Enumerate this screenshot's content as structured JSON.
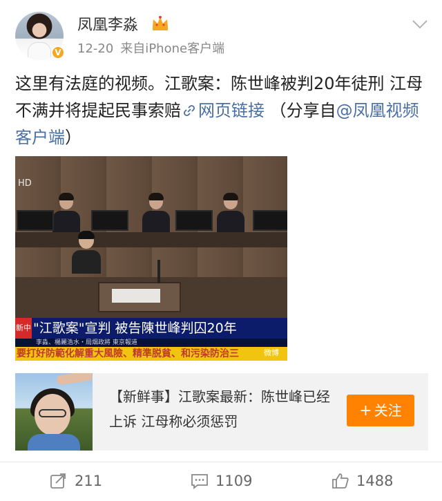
{
  "user": {
    "name": "凤凰李淼",
    "verified_badge": "V",
    "time": "12-20",
    "source": "来自iPhone客户端"
  },
  "post": {
    "text": "这里有法庭的视频。江歌案：陈世峰被判20年徒刑 江母不满并将提起民事索赔",
    "link_label": "网页链接",
    "share_prefix": "（分享自",
    "share_mention": "@凤凰视频客户端",
    "share_suffix": "）"
  },
  "video": {
    "hd_label": "HD",
    "channel_logo": "新中",
    "headline": "\"江歌案\"宣判 被告陳世峰判囚20年",
    "subline": "李淼、楊麗浩水・局烟政將  東京報道",
    "ticker": "要打好防範化解重大風險、精準脱貧、和污染防治三",
    "watermark": "微博"
  },
  "related": {
    "text": "【新鲜事】江歌案最新：陈世峰已经上诉 江母称必须惩罚",
    "follow_label": "关注",
    "follow_plus": "+"
  },
  "actions": {
    "repost_count": "211",
    "comment_count": "1109",
    "like_count": "1488"
  },
  "colors": {
    "accent": "#ff8200",
    "link": "#4a6fa5",
    "crown": "#f5a623",
    "ticker_bg": "#f1c40f",
    "lower_third_bg": "#0c1c6a"
  },
  "icons": {
    "more": "chevron-down-icon",
    "crown": "crown-icon",
    "link": "link-icon",
    "repost": "repost-icon",
    "comment": "comment-icon",
    "like": "thumbs-up-icon"
  }
}
